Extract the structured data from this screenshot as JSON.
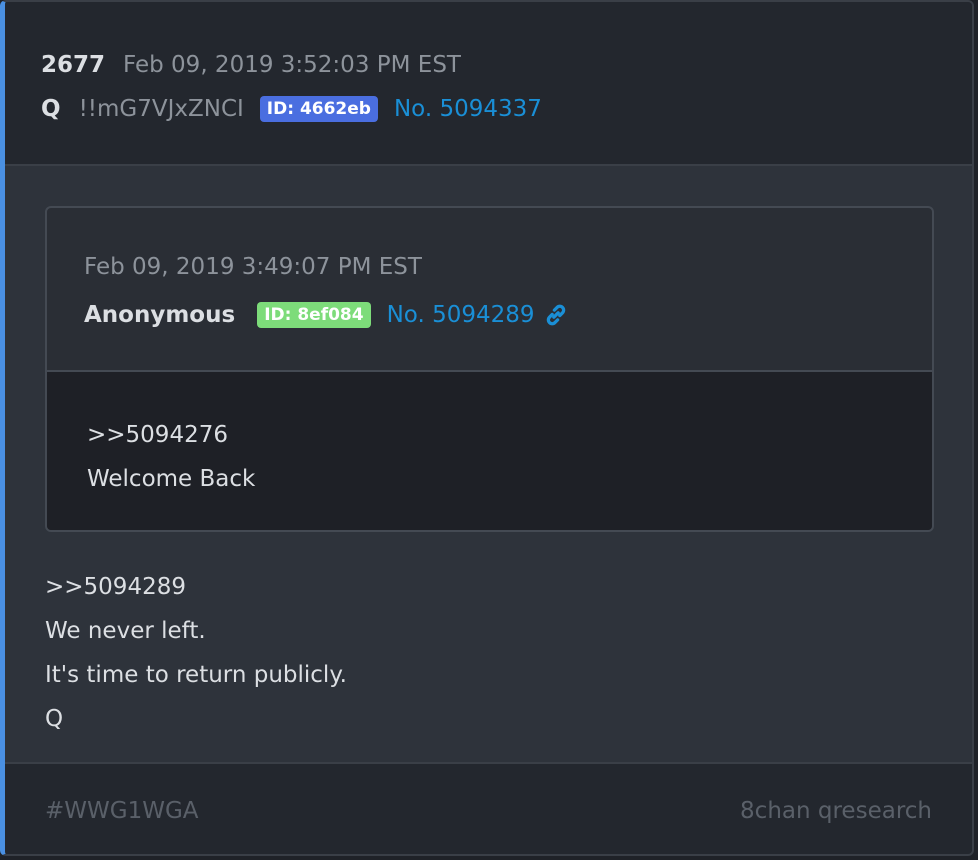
{
  "drop": {
    "number": "2677",
    "timestamp": "Feb 09, 2019 3:52:03 PM EST",
    "author": "Q",
    "tripcode": "!!mG7VJxZNCI",
    "id_badge": "ID: 4662eb",
    "post_no": "No. 5094337"
  },
  "quoted": {
    "timestamp": "Feb 09, 2019 3:49:07 PM EST",
    "author": "Anonymous",
    "id_badge": "ID: 8ef084",
    "post_no": "No. 5094289",
    "lines": [
      ">>5094276",
      "Welcome Back"
    ]
  },
  "body": {
    "lines": [
      ">>5094289",
      "We never left.",
      "It's time to return publicly.",
      "Q"
    ]
  },
  "footer": {
    "hashtag": "#WWG1WGA",
    "source": "8chan qresearch"
  },
  "colors": {
    "accent": "#4a90e2",
    "link": "#1a8fd6",
    "id_blue": "#4a6ee0",
    "id_green": "#7ddc7a"
  },
  "icons": {
    "permalink": "link-icon"
  }
}
